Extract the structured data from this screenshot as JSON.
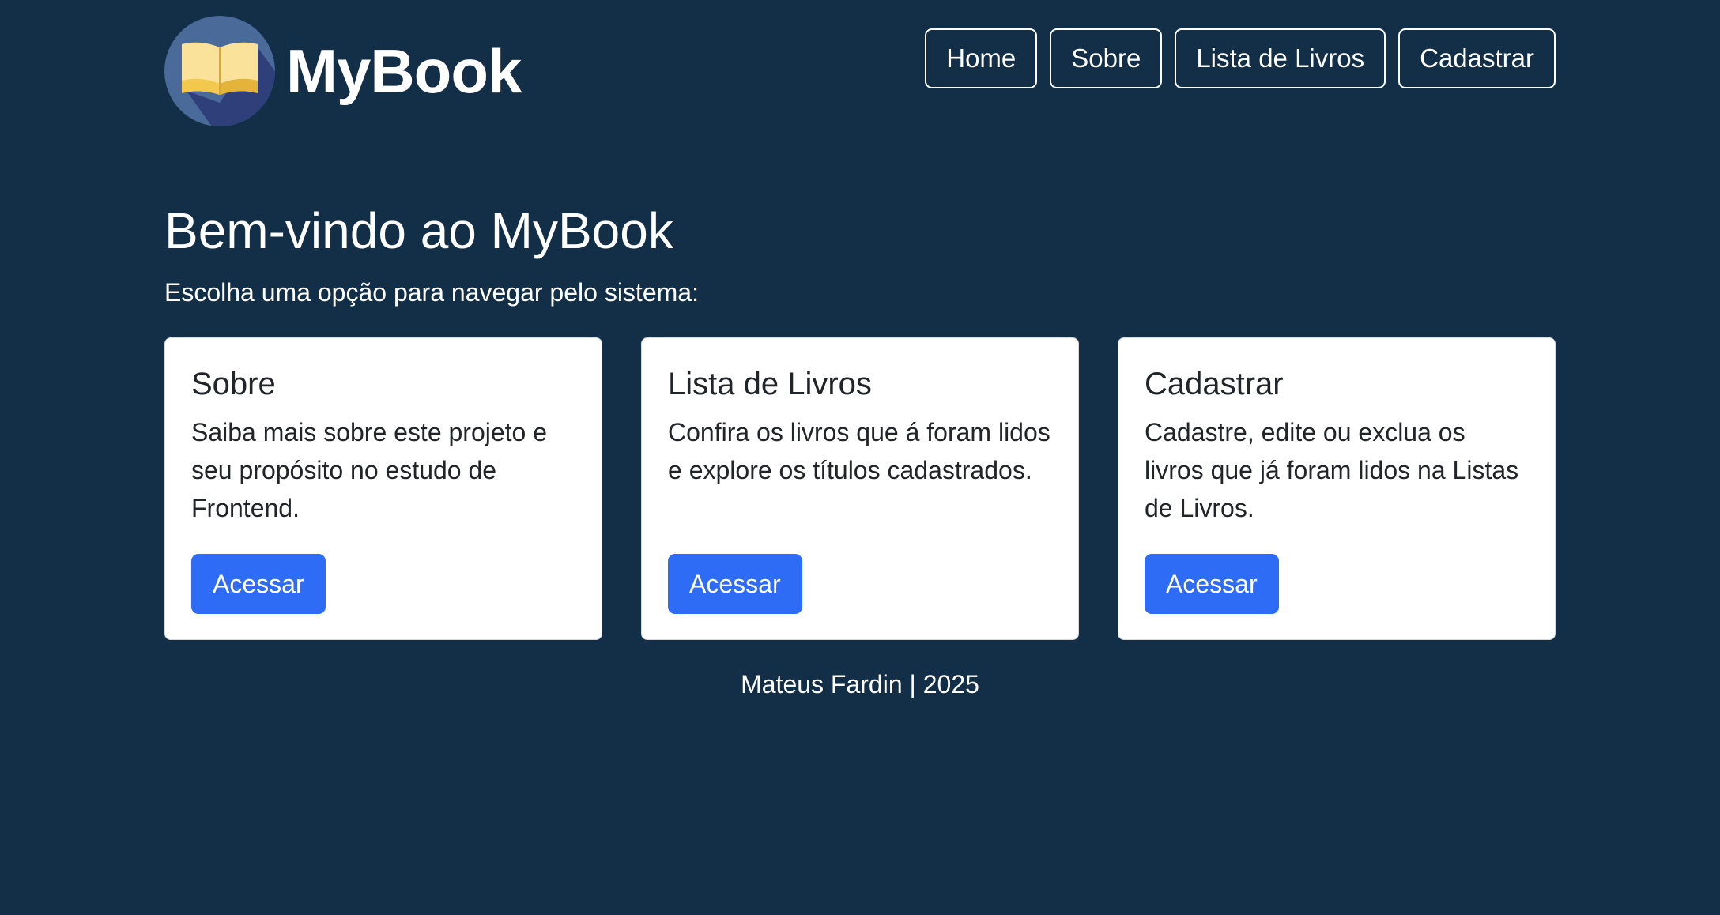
{
  "brand": {
    "name": "MyBook",
    "logo_icon": "open-book-icon"
  },
  "nav": {
    "items": [
      {
        "label": "Home"
      },
      {
        "label": "Sobre"
      },
      {
        "label": "Lista de Livros"
      },
      {
        "label": "Cadastrar"
      }
    ]
  },
  "hero": {
    "title": "Bem-vindo ao MyBook",
    "subtitle": "Escolha uma opção para navegar pelo sistema:"
  },
  "cards": [
    {
      "title": "Sobre",
      "text": "Saiba mais sobre este projeto e seu propósito no estudo de Frontend.",
      "button": "Acessar"
    },
    {
      "title": "Lista de Livros",
      "text": "Confira os livros que á foram lidos e explore os títulos cadastrados.",
      "button": "Acessar"
    },
    {
      "title": "Cadastrar",
      "text": "Cadastre, edite ou exclua os livros que já foram lidos na Listas de Livros.",
      "button": "Acessar"
    }
  ],
  "footer": {
    "text": "Mateus Fardin | 2025"
  },
  "colors": {
    "background": "#132f47",
    "primary_button": "#2f6cf5",
    "card_background": "#ffffff"
  }
}
